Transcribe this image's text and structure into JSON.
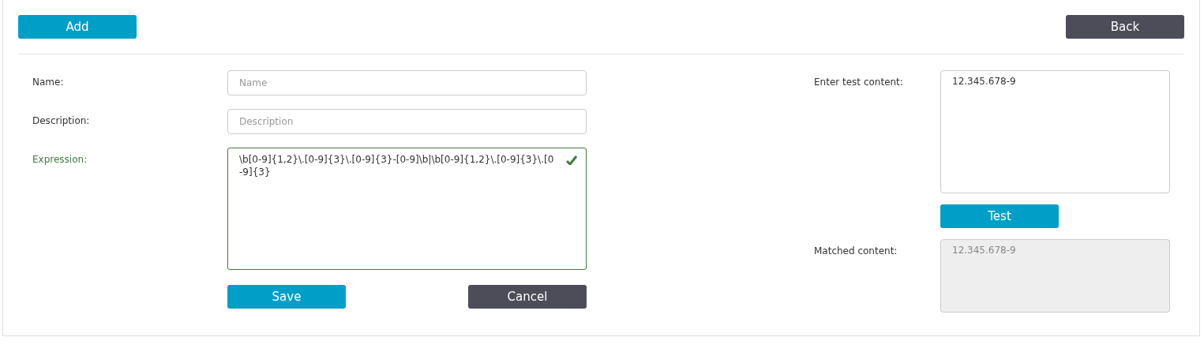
{
  "toolbar": {
    "add_button": "Add",
    "back_button": "Back"
  },
  "form": {
    "fields": [
      {
        "label": "Name:",
        "kind": "input",
        "placeholder": "Name"
      },
      {
        "label": "Description:",
        "kind": "input",
        "placeholder": "Description"
      },
      {
        "label": "Expression:",
        "kind": "textarea",
        "value": "\\b[0-9]{1,2}\\.[0-9]{3}\\.[0-9]{3}-[0-9]\\b|\\b[0-9]{1,2}\\.[0-9]{3}\\.[0-9]{3}",
        "valid": true
      }
    ],
    "save_button": "Save",
    "cancel_button": "Cancel"
  },
  "tester": {
    "test_label": "Enter test content:",
    "test_value": "12.345.678-9",
    "test_button": "Test",
    "matched_label": "Matched content:",
    "matched_value": "12.345.678-9"
  }
}
